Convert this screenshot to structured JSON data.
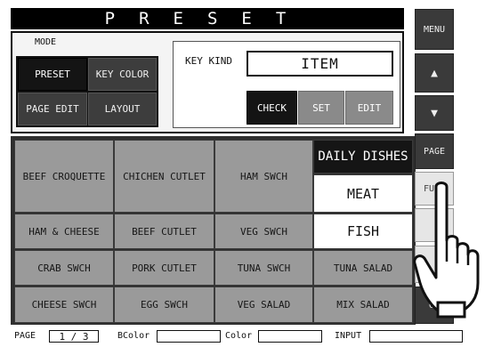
{
  "title": "PRESET",
  "mode": {
    "label": "MODE",
    "buttons": [
      "PRESET",
      "KEY COLOR",
      "PAGE EDIT",
      "LAYOUT"
    ]
  },
  "key_kind": {
    "label": "KEY KIND",
    "value": "ITEM",
    "buttons": [
      "CHECK",
      "SET",
      "EDIT"
    ]
  },
  "grid": {
    "rows": [
      [
        "BEEF CROQUETTE",
        "CHICHEN CUTLET",
        "HAM SWCH",
        "DAILY DISHES"
      ],
      [
        "",
        "",
        "",
        "MEAT"
      ],
      [
        "HAM & CHEESE",
        "BEEF CUTLET",
        "VEG SWCH",
        "FISH"
      ],
      [
        "CRAB SWCH",
        "PORK CUTLET",
        "TUNA SWCH",
        "TUNA SALAD"
      ],
      [
        "CHEESE SWCH",
        "EGG SWCH",
        "VEG SALAD",
        "MIX SALAD"
      ]
    ]
  },
  "sidebar": {
    "menu": "MENU",
    "up": "▲",
    "down": "▼",
    "page": "PAGE",
    "func": "FUNC",
    "op": "OP"
  },
  "status": {
    "page_label": "PAGE",
    "page_value": "1 / 3",
    "bcolor_label": "BColor",
    "bcolor_value": "",
    "color_label": "Color",
    "color_value": "",
    "input_label": "INPUT",
    "input_value": ""
  }
}
